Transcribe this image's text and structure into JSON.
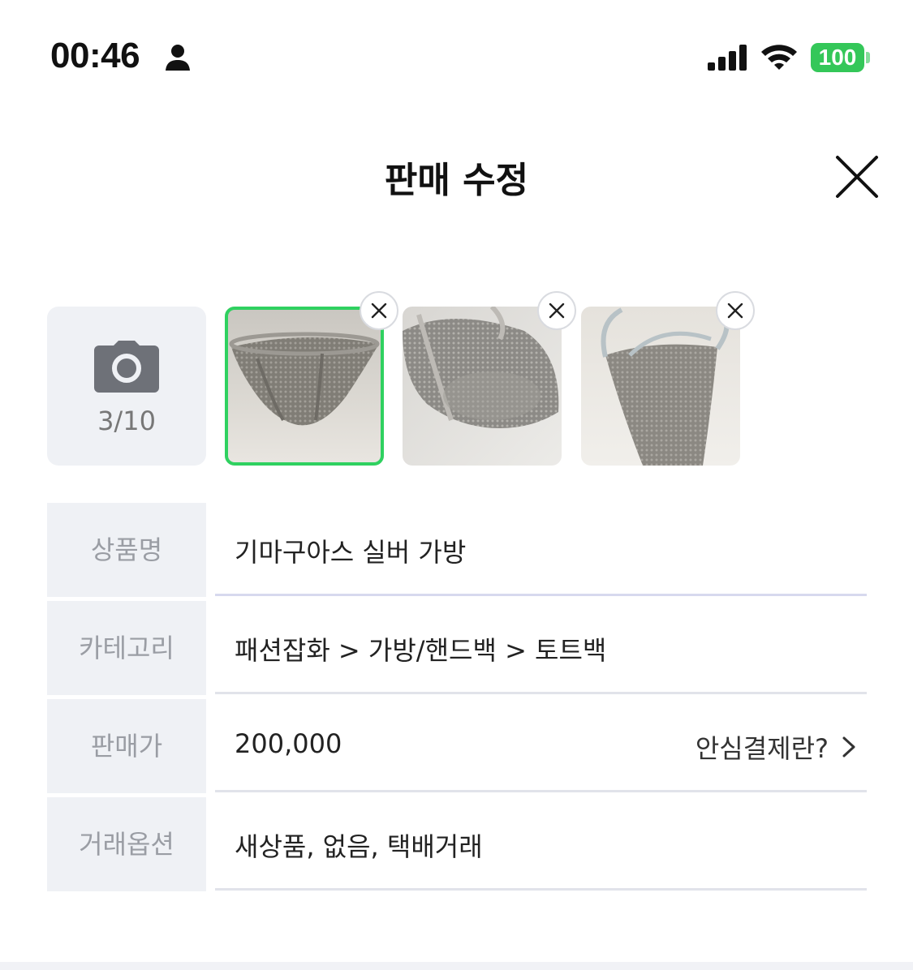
{
  "status_bar": {
    "time": "00:46",
    "battery": "100",
    "icons": [
      "person-icon",
      "cellular-signal-icon",
      "wifi-icon",
      "battery-icon"
    ],
    "battery_color": "#34c759"
  },
  "header": {
    "title": "판매 수정",
    "close_icon": "close-icon"
  },
  "photos": {
    "count": "3/10",
    "camera_icon": "camera-icon",
    "selected_border_color": "#2fd160",
    "items": [
      {
        "selected": true
      },
      {
        "selected": false
      },
      {
        "selected": false
      }
    ]
  },
  "form": {
    "rows": [
      {
        "label": "상품명",
        "value": "기마구아스 실버 가방"
      },
      {
        "label": "카테고리",
        "value": "패션잡화 > 가방/핸드백 > 토트백"
      },
      {
        "label": "판매가",
        "value": "200,000",
        "link": "안심결제란?"
      },
      {
        "label": "거래옵션",
        "value": "새상품, 없음, 택배거래"
      }
    ],
    "label_bg": "#eff1f5"
  }
}
